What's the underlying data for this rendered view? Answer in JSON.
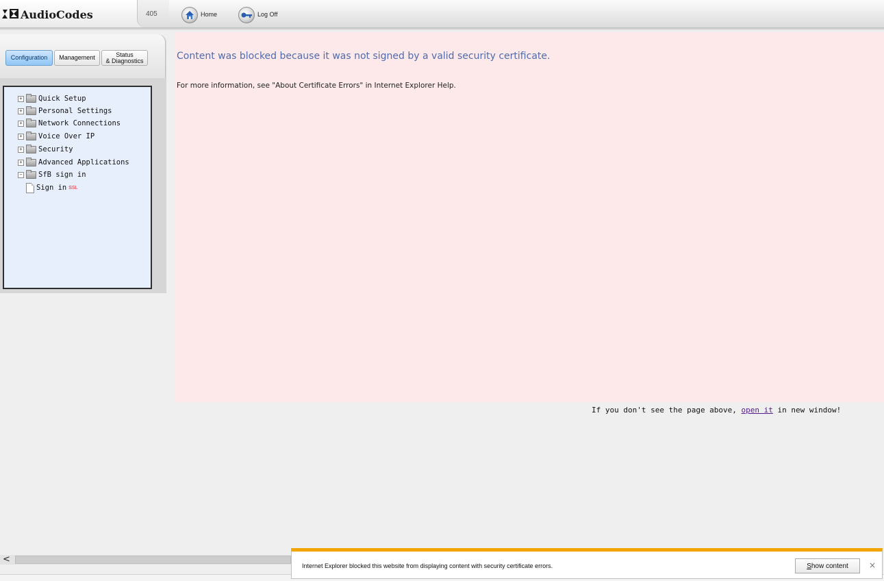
{
  "header": {
    "logo_text": "AudioCodes",
    "unit_number": "405",
    "home_label": "Home",
    "logoff_label": "Log Off"
  },
  "tabs": [
    {
      "label": "Configuration",
      "active": true
    },
    {
      "label": "Management",
      "active": false
    },
    {
      "label": "Status\n& Diagnostics",
      "active": false
    }
  ],
  "tree": {
    "items": [
      {
        "label": "Quick Setup",
        "expander": "+"
      },
      {
        "label": "Personal Settings",
        "expander": "+"
      },
      {
        "label": "Network Connections",
        "expander": "+"
      },
      {
        "label": "Voice Over IP",
        "expander": "+"
      },
      {
        "label": "Security",
        "expander": "+"
      },
      {
        "label": "Advanced Applications",
        "expander": "+"
      },
      {
        "label": "SfB sign in",
        "expander": "−"
      }
    ],
    "child": {
      "label": "Sign in",
      "badge": "SSL"
    }
  },
  "blocked": {
    "heading": "Content was blocked because it was not signed by a valid security certificate.",
    "info": "For more information, see \"About Certificate Errors\" in Internet Explorer Help."
  },
  "fallback": {
    "before": "If you don't see the page above, ",
    "link": "open it",
    "after": " in new window!"
  },
  "scrollbar": {
    "left_arrow": "<"
  },
  "notification": {
    "message": "Internet Explorer blocked this website from displaying content with security certificate errors.",
    "button_label": "Show content",
    "close_glyph": "×"
  },
  "colors": {
    "blocked_background": "#fde9ea",
    "heading_blue": "#4f6bad",
    "notification_accent": "#f2a500",
    "active_tab": "#8fc6f5",
    "link_visited": "#551a8b"
  }
}
